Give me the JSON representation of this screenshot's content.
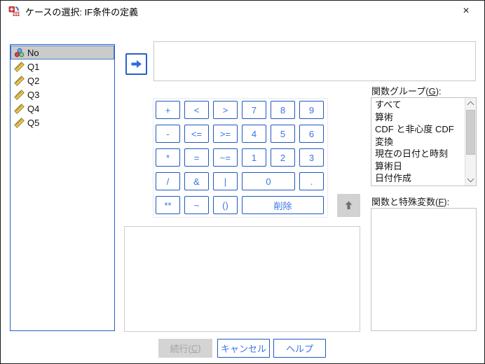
{
  "window": {
    "title": "ケースの選択: IF条件の定義",
    "close_glyph": "×"
  },
  "colors": {
    "accent_blue": "#2158c1",
    "key_text_blue": "#3b74e8",
    "selection_gray": "#cbcbcb",
    "disabled_bg": "#d4d4d4",
    "disabled_text": "#a3a3a3",
    "box_border": "#c8c8c8"
  },
  "variables": {
    "items": [
      {
        "name": "No",
        "type": "nominal",
        "selected": true
      },
      {
        "name": "Q1",
        "type": "scale",
        "selected": false
      },
      {
        "name": "Q2",
        "type": "scale",
        "selected": false
      },
      {
        "name": "Q3",
        "type": "scale",
        "selected": false
      },
      {
        "name": "Q4",
        "type": "scale",
        "selected": false
      },
      {
        "name": "Q5",
        "type": "scale",
        "selected": false
      }
    ]
  },
  "expression": {
    "value": ""
  },
  "keypad": {
    "rows": [
      [
        {
          "label": "+"
        },
        {
          "label": "<"
        },
        {
          "label": ">"
        },
        {
          "label": "7"
        },
        {
          "label": "8"
        },
        {
          "label": "9"
        }
      ],
      [
        {
          "label": "-"
        },
        {
          "label": "<="
        },
        {
          "label": ">="
        },
        {
          "label": "4"
        },
        {
          "label": "5"
        },
        {
          "label": "6"
        }
      ],
      [
        {
          "label": "*"
        },
        {
          "label": "="
        },
        {
          "label": "~="
        },
        {
          "label": "1"
        },
        {
          "label": "2"
        },
        {
          "label": "3"
        }
      ],
      [
        {
          "label": "/"
        },
        {
          "label": "&"
        },
        {
          "label": "|"
        },
        {
          "label": "0",
          "span": 2
        },
        {
          "label": "."
        }
      ],
      [
        {
          "label": "**"
        },
        {
          "label": "~"
        },
        {
          "label": "()"
        },
        {
          "label": "削除",
          "span": 3
        }
      ]
    ]
  },
  "right_panel": {
    "group_label": {
      "pre": "関数グループ(",
      "key": "G",
      "post": "):"
    },
    "groups": [
      "すべて",
      "算術",
      "CDF と非心度 CDF",
      "変換",
      "現在の日付と時刻",
      "算術日",
      "日付作成"
    ],
    "functions_label": {
      "pre": "関数と特殊変数(",
      "key": "F",
      "post": "):"
    },
    "functions": []
  },
  "buttons": {
    "continue": {
      "pre": "続行(",
      "key": "C",
      "post": ")"
    },
    "cancel": "キャンセル",
    "help": "ヘルプ"
  }
}
